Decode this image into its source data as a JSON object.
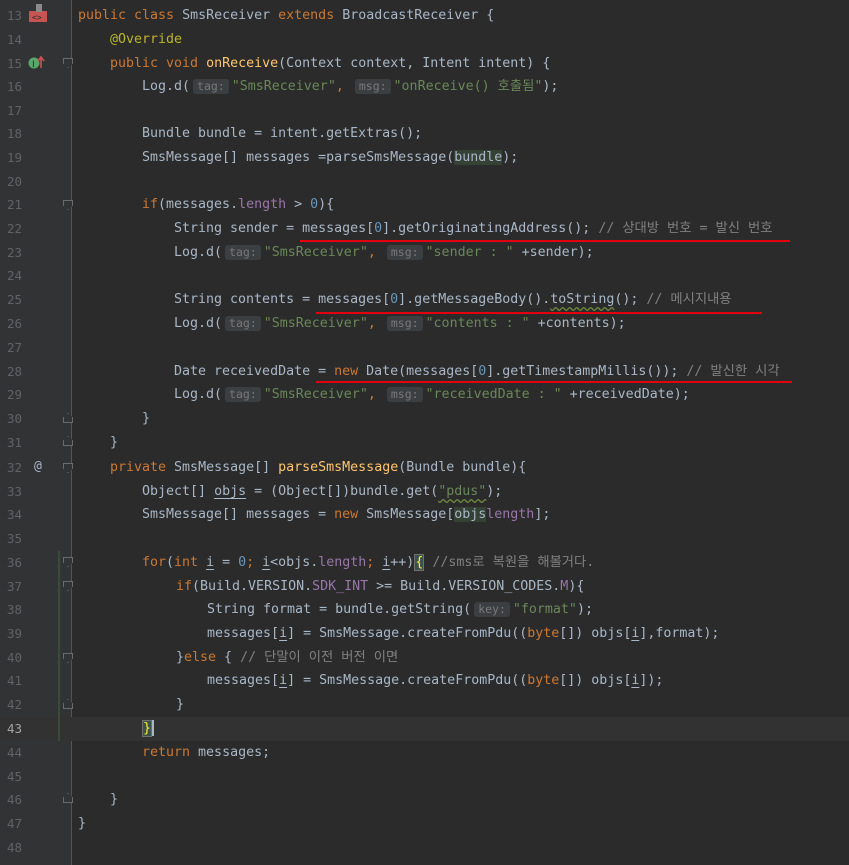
{
  "editor": {
    "current_line": 43,
    "lines": [
      {
        "n": "13"
      },
      {
        "n": "14"
      },
      {
        "n": "15"
      },
      {
        "n": "16"
      },
      {
        "n": "17"
      },
      {
        "n": "18"
      },
      {
        "n": "19"
      },
      {
        "n": "20"
      },
      {
        "n": "21"
      },
      {
        "n": "22"
      },
      {
        "n": "23"
      },
      {
        "n": "24"
      },
      {
        "n": "25"
      },
      {
        "n": "26"
      },
      {
        "n": "27"
      },
      {
        "n": "28"
      },
      {
        "n": "29"
      },
      {
        "n": "30"
      },
      {
        "n": "31"
      },
      {
        "n": "32"
      },
      {
        "n": "33"
      },
      {
        "n": "34"
      },
      {
        "n": "35"
      },
      {
        "n": "36"
      },
      {
        "n": "37"
      },
      {
        "n": "38"
      },
      {
        "n": "39"
      },
      {
        "n": "40"
      },
      {
        "n": "41"
      },
      {
        "n": "42"
      },
      {
        "n": "43"
      },
      {
        "n": "44"
      },
      {
        "n": "45"
      },
      {
        "n": "46"
      },
      {
        "n": "47"
      },
      {
        "n": "48"
      }
    ]
  },
  "code": {
    "l13": {
      "kw1": "public class ",
      "cls": "SmsReceiver ",
      "kw2": "extends ",
      "base": "BroadcastReceiver {"
    },
    "l14": {
      "ann": "@Override"
    },
    "l15": {
      "kw": "public void ",
      "fn": "onReceive",
      "rest": "(Context context, Intent intent) {"
    },
    "l16": {
      "a": "Log.d(",
      "h1": "tag:",
      "s1": "\"SmsReceiver\"",
      ",": ", ",
      "h2": "msg:",
      "s2": "\"onReceive() 호출됨\"",
      "end": ");"
    },
    "l18": {
      "t": "Bundle bundle = intent.getExtras();"
    },
    "l19": {
      "a": "SmsMessage[] messages =parseSmsMessage(",
      "b": "bundle",
      "c": ");"
    },
    "l21": {
      "kw": "if",
      "a": "(messages.",
      "fd": "length",
      "b": " > ",
      "nm": "0",
      "c": "){"
    },
    "l22": {
      "a": "String sender = messages[",
      "nm": "0",
      "b": "].getOriginatingAddress(); ",
      "cm": "// 상대방 번호 = 발신 번호"
    },
    "l23": {
      "a": "Log.d(",
      "h1": "tag:",
      "s1": "\"SmsReceiver\"",
      ",": ", ",
      "h2": "msg:",
      "s2": "\"sender : \"",
      "end": " +sender);"
    },
    "l25": {
      "a": "String contents = messages[",
      "nm": "0",
      "b": "].getMessageBody().",
      "c": "toString",
      "d": "(); ",
      "cm": "// 메시지내용"
    },
    "l26": {
      "a": "Log.d(",
      "h1": "tag:",
      "s1": "\"SmsReceiver\"",
      ",": ", ",
      "h2": "msg:",
      "s2": "\"contents : \"",
      "end": " +contents);"
    },
    "l28": {
      "a": "Date receivedDate = ",
      "kw": "new ",
      "b": "Date(messages[",
      "nm": "0",
      "c": "].getTimestampMillis()); ",
      "cm": "// 발신한 시각"
    },
    "l29": {
      "a": "Log.d(",
      "h1": "tag:",
      "s1": "\"SmsReceiver\"",
      ",": ", ",
      "h2": "msg:",
      "s2": "\"receivedDate : \"",
      "end": " +receivedDate);"
    },
    "l30": {
      "t": "}"
    },
    "l31": {
      "t": "}"
    },
    "l32": {
      "kw": "private ",
      "a": "SmsMessage[] ",
      "fn": "parseSmsMessage",
      "b": "(Bundle bundle){"
    },
    "l33": {
      "a": "Object[] ",
      "v": "objs",
      "b": " = (Object[])bundle.get(",
      "s": "\"pdus\"",
      "c": ");"
    },
    "l34": {
      "a": "SmsMessage[] messages = ",
      "kw": "new ",
      "b": "SmsMessage[",
      "v": "objs",
      ".": ".",
      "fd": "length",
      "c": "];"
    },
    "l36": {
      "kw1": "for",
      "a": "(",
      "kw2": "int ",
      "v1": "i",
      "b": " = ",
      "nm": "0",
      "c": "; ",
      "v2": "i",
      "d": "<objs.",
      "fd": "length",
      "e": "; ",
      "v3": "i",
      "f": "++)",
      "g": "{",
      "h": " ",
      "cm": "//sms로 복원을 해볼거다."
    },
    "l37": {
      "kw": "if",
      "a": "(Build.VERSION.",
      "fd": "SDK_INT",
      "b": " >= Build.VERSION_CODES.",
      "fd2": "M",
      "c": "){"
    },
    "l38": {
      "a": "String format = bundle.getString(",
      "h": "key:",
      "s": "\"format\"",
      "c": ");"
    },
    "l39": {
      "a": "messages[",
      "v1": "i",
      "b": "] = SmsMessage.createFromPdu((",
      "kw": "byte",
      "c": "[]) objs[",
      "v2": "i",
      "d": "],format);"
    },
    "l40": {
      "a": "}",
      "kw": "else ",
      "b": "{ ",
      "cm": "// 단말이 이전 버전 이면"
    },
    "l41": {
      "a": "messages[",
      "v1": "i",
      "b": "] = SmsMessage.createFromPdu((",
      "kw": "byte",
      "c": "[]) objs[",
      "v2": "i",
      "d": "]);"
    },
    "l42": {
      "t": "}"
    },
    "l43": {
      "t": "}"
    },
    "l44": {
      "kw": "return ",
      "a": "messages;"
    },
    "l46": {
      "t": "}"
    },
    "l47": {
      "t": "}"
    }
  }
}
